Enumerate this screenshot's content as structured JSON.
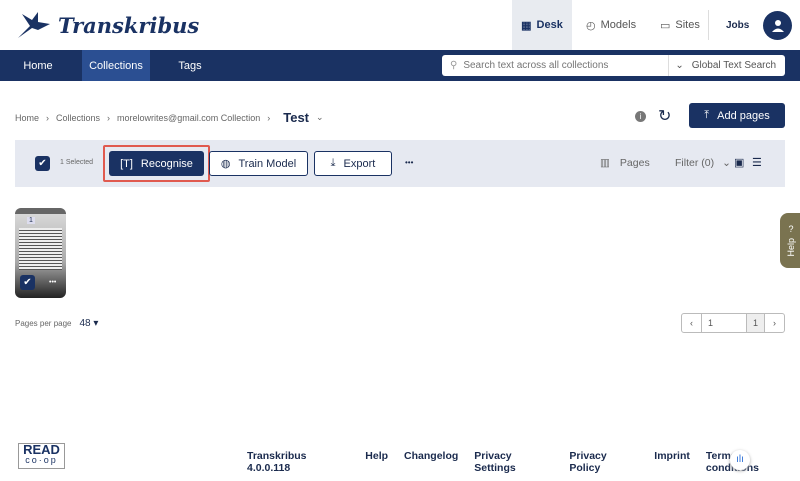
{
  "app": {
    "name": "Transkribus"
  },
  "top_nav": [
    {
      "label": "Desk",
      "icon": "desk-icon"
    },
    {
      "label": "Models",
      "icon": "models-icon"
    },
    {
      "label": "Sites",
      "icon": "sites-icon"
    },
    {
      "label": "Jobs"
    }
  ],
  "nav": {
    "items": [
      "Home",
      "Collections",
      "Tags"
    ],
    "search_placeholder": "Search text across all collections",
    "search_mode": "Global Text Search"
  },
  "breadcrumb": [
    "Home",
    "Collections",
    "morelowrites@gmail.com Collection"
  ],
  "collection_title": "Test",
  "add_pages": "Add pages",
  "toolbar": {
    "selected": "1 Selected",
    "recognise": "Recognise",
    "train": "Train Model",
    "export": "Export",
    "more": "•••",
    "pages": "Pages",
    "filter": "Filter (0)"
  },
  "thumbnail": {
    "number": "1",
    "more": "•••"
  },
  "pages_per_page": {
    "label": "Pages per page",
    "value": "48"
  },
  "pagination": {
    "current": "1",
    "total": "1"
  },
  "footer": {
    "logo_top": "READ",
    "logo_bottom": "co·op",
    "links": [
      "Transkribus 4.0.0.118",
      "Help",
      "Changelog",
      "Privacy Settings",
      "Privacy Policy",
      "Imprint",
      "Terms & conditions"
    ]
  },
  "help_tab": "Help",
  "colors": {
    "navy": "#1a3263",
    "highlight": "#e05a4f",
    "help": "#7a7350"
  }
}
